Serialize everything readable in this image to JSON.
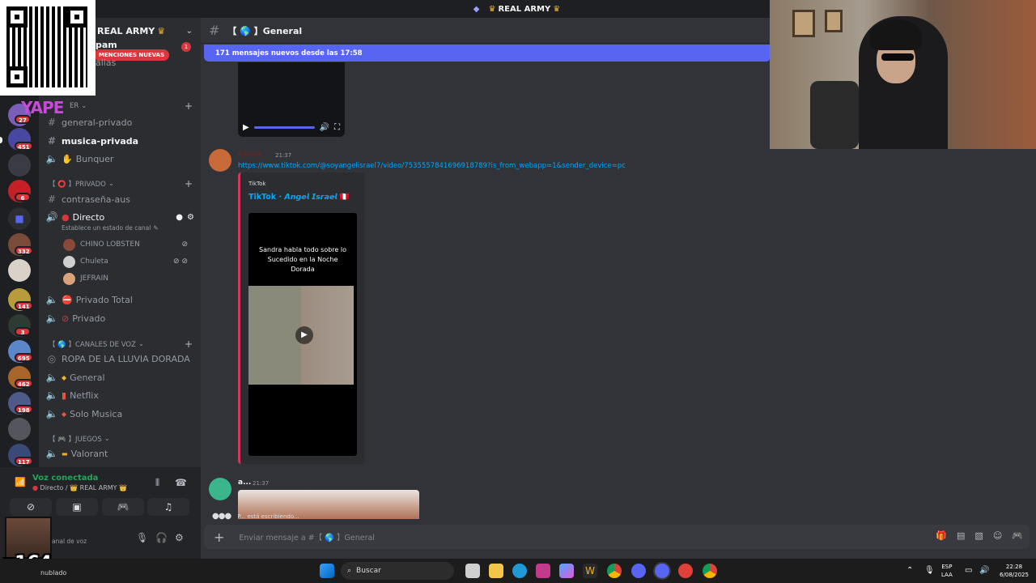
{
  "titlebar": {
    "server_name": "REAL ARMY"
  },
  "server": {
    "name": "REAL ARMY",
    "mentions_pill": "MENCIONES NUEVAS",
    "unread_count": "1",
    "partial_top": "pam",
    "partial_second": "allas"
  },
  "rail": {
    "badges": [
      "27",
      "451",
      "6",
      "332",
      "141",
      "3",
      "695",
      "462",
      "198",
      "117"
    ]
  },
  "sidebar": {
    "category_top": "ER",
    "rows_top": [
      {
        "label": "general-privado",
        "icon": "#"
      },
      {
        "label": "musica-privada",
        "icon": "#"
      },
      {
        "label": "Bunquer",
        "icon": "🔊"
      }
    ],
    "category_privado": "【 ⭕ 】PRIVADO",
    "contrasena": "contraseña-aus",
    "directo": "Directo",
    "directo_status": "Establece un estado de canal",
    "voice_users": [
      "CHINO LOBSTEN",
      "Chuleta",
      "JEFRAIN"
    ],
    "privado_total": "Privado Total",
    "privado": "Privado",
    "category_voz": "【 🌎 】Canales de voz",
    "voz_channels": [
      "ROPA DE LA LLUVIA DORADA",
      "General",
      "Netflix",
      "Solo Musica"
    ],
    "category_juegos": "【 🎮 】Juegos",
    "valorant": "Valorant"
  },
  "voice_panel": {
    "status": "Voz conectada",
    "location": "Directo / 👑 REAL ARMY 👑",
    "partial_label": "anal de voz"
  },
  "chat": {
    "channel": "【 🌎 】General",
    "new_messages": "171 mensajes nuevos desde las 17:58",
    "message1": {
      "author": "Ghost",
      "time": "21:37",
      "link": "https://www.tiktok.com/@soyangelisrael7/video/7535557841696918789?is_from_webapp=1&sender_device=pc",
      "embed_provider": "TikTok",
      "embed_title": "TikTok · 𝘼𝙣𝙜𝙚𝙡 𝙄𝙨𝙧𝙖𝙚𝙡 🇵🇪",
      "video_text": "Sandra habla todo sobre lo Sucedido en la Noche Dorada"
    },
    "message2": {
      "author": "a...",
      "time": "21:37"
    },
    "typing": "P... está escribiendo...",
    "composer_placeholder": "Enviar mensaje a #【 🌎 】General"
  },
  "overlays": {
    "yape": "YAPE",
    "multiplier": "x164"
  },
  "taskbar": {
    "search": "Buscar",
    "left_text": "nublado",
    "lang_1": "ESP",
    "lang_2": "LAA",
    "time": "22:28",
    "date": "6/08/2025"
  }
}
